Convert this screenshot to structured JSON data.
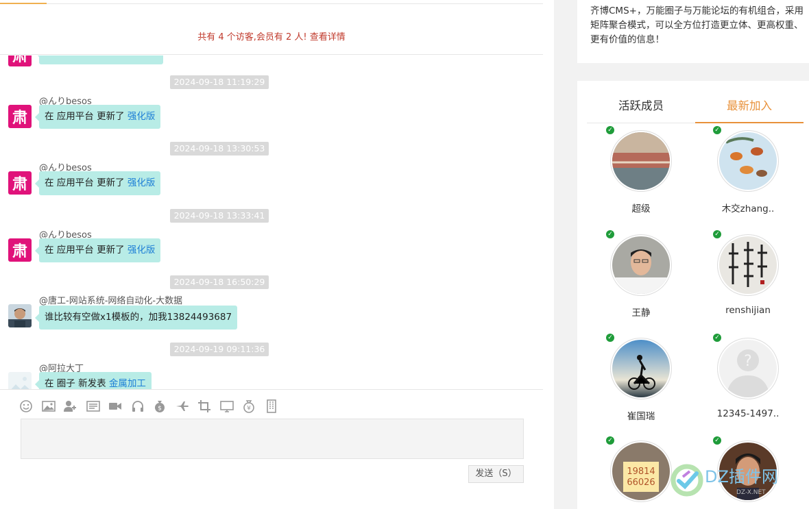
{
  "visitor_bar": {
    "text": "共有 4 个访客,会员有 2 人! ",
    "link": "查看详情"
  },
  "messages": [
    {
      "time": "2024-09-18 11:19:29",
      "user": "@んりbesos",
      "avatar": "shu-logo",
      "prefix": "在 应用平台 更新了 ",
      "link": "强化版"
    },
    {
      "time": "2024-09-18 13:30:53",
      "user": "@んりbesos",
      "avatar": "shu-logo",
      "prefix": "在 应用平台 更新了 ",
      "link": "强化版"
    },
    {
      "time": "2024-09-18 13:33:41",
      "user": "@んりbesos",
      "avatar": "shu-logo",
      "prefix": "在 应用平台 更新了 ",
      "link": "强化版"
    },
    {
      "time": "2024-09-18 16:50:29",
      "user": "@唐工-网站系统-网络自动化-大数据",
      "avatar": "photo-man",
      "prefix": "谁比较有空做x1模板的，加我13824493687",
      "link": ""
    },
    {
      "time": "2024-09-19 09:11:36",
      "user": "@阿拉大丁",
      "avatar": "placeholder-image",
      "prefix": "在 圈子 新发表 ",
      "link": "金属加工"
    }
  ],
  "avatar_glyph": "肃",
  "toolbar_icons": [
    "smiley-icon",
    "image-icon",
    "add-user-icon",
    "card-icon",
    "video-icon",
    "headphones-icon",
    "money-bag-icon",
    "plane-icon",
    "crop-icon",
    "monitor-icon",
    "yen-bag-icon",
    "building-icon"
  ],
  "send_label": "发送（S）",
  "intro_text": "齐博CMS+，万能圈子与万能论坛的有机组合，采用矩阵聚合模式，可以全方位打造更立体、更高权重、更有价值的信息！",
  "tabs": [
    {
      "label": "活跃成员",
      "active": false
    },
    {
      "label": "最新加入",
      "active": true
    }
  ],
  "members": [
    {
      "name": "超级",
      "pic": "building-photo"
    },
    {
      "name": "木交zhang..",
      "pic": "birds-photo"
    },
    {
      "name": "王静",
      "pic": "man-photo"
    },
    {
      "name": "renshijian",
      "pic": "calligraphy-photo"
    },
    {
      "name": "崔国瑞",
      "pic": "cyclist-photo"
    },
    {
      "name": "12345-1497..",
      "pic": "default-avatar"
    },
    {
      "name": "",
      "pic": "number-sign-photo",
      "pic_text_1": "19814",
      "pic_text_2": "66026"
    },
    {
      "name": "",
      "pic": "portrait-photo"
    }
  ],
  "watermark": {
    "text": "DZ插件网",
    "sub": "DZ-X.NET"
  },
  "colors": {
    "accent": "#e8913a",
    "bubble": "#b8ece6",
    "link": "#1e7fd6",
    "visitor": "#c0392b",
    "logo": "#e0127a",
    "online": "#1f9c3a"
  }
}
